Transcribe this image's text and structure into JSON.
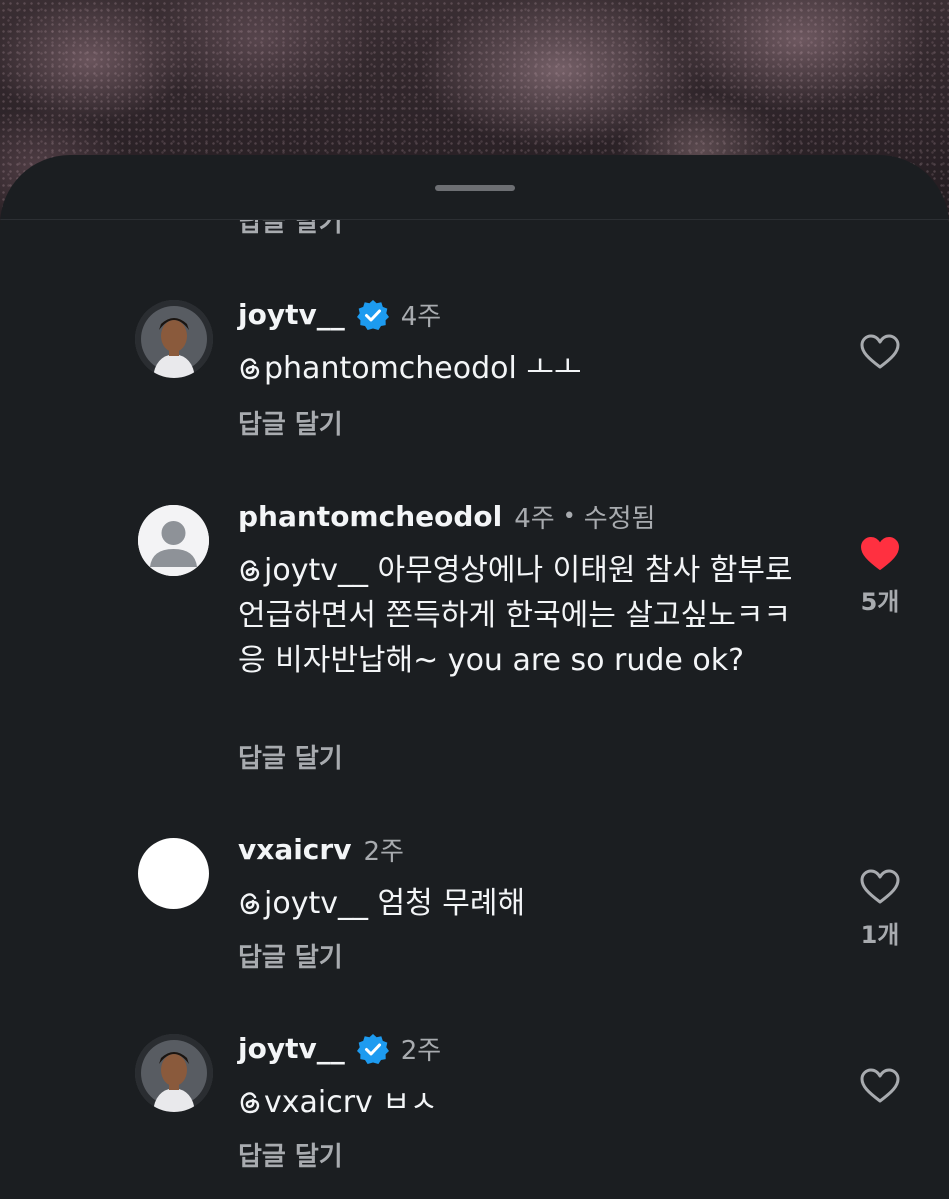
{
  "colors": {
    "sheet_bg": "#1b1e21",
    "text": "#f3f5f7",
    "muted": "#a8abaf",
    "verified": "#1d9bf0",
    "liked": "#ff3040"
  },
  "top_partial": {
    "reply_label": "답글 달기"
  },
  "comments": [
    {
      "username": "joytv__",
      "verified": true,
      "time": "4주",
      "edited": "",
      "mention": "phantomcheodol",
      "text": " ㅗㅗ",
      "reply_label": "답글 달기",
      "liked": false,
      "like_count": "",
      "avatar": "profile-photo"
    },
    {
      "username": "phantomcheodol",
      "verified": false,
      "time": "4주",
      "separator": "•",
      "edited": "수정됨",
      "mention": "joytv__",
      "text": " 아무영상에나 이태원 참사 함부로 언급하면서 쫀득하게 한국에는 살고싶노ㅋㅋ 응 비자반납해~ you are so rude ok?",
      "reply_label": "답글 달기",
      "liked": true,
      "like_count": "5개",
      "avatar": "default-avatar"
    },
    {
      "username": "vxaicrv",
      "verified": false,
      "time": "2주",
      "edited": "",
      "mention": "joytv__",
      "text": " 엄청 무례해",
      "reply_label": "답글 달기",
      "liked": false,
      "like_count": "1개",
      "avatar": "blank-avatar"
    },
    {
      "username": "joytv__",
      "verified": true,
      "time": "2주",
      "edited": "",
      "mention": "vxaicrv",
      "text": " ㅂㅅ",
      "reply_label": "답글 달기",
      "liked": false,
      "like_count": "",
      "avatar": "profile-photo"
    }
  ]
}
